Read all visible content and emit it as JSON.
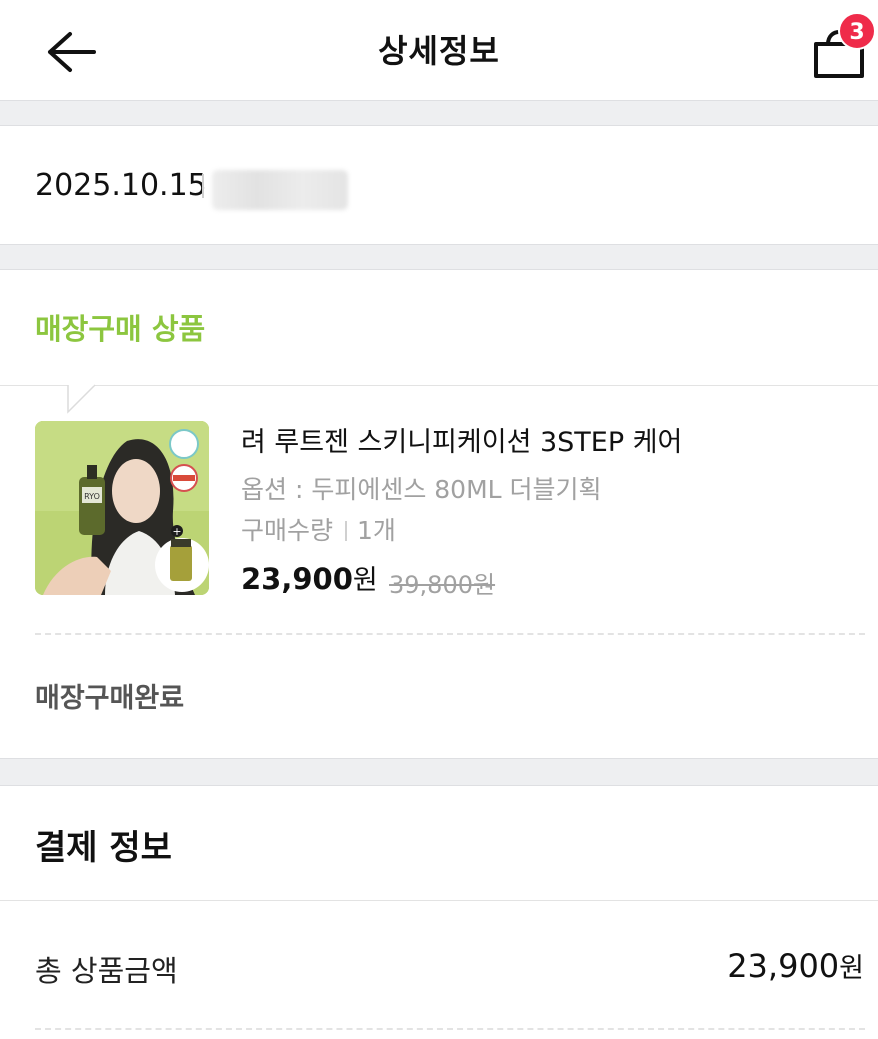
{
  "header": {
    "title": "상세정보",
    "cart_count": "3",
    "back_icon": "arrow-left-icon",
    "cart_icon": "shopping-bag-icon"
  },
  "order": {
    "date": "2025.10.15"
  },
  "instore": {
    "label": "매장구매 상품",
    "accent_color": "#8cc63f",
    "product": {
      "name": "려 루트젠 스키니피케이션 3STEP 케어",
      "option": "옵션 : 두피에센스 80ML 더블기획",
      "qty_label": "구매수량",
      "qty_value": "1개",
      "price": "23,900",
      "price_unit": "원",
      "original_price": "39,800원",
      "brand": "RYO"
    },
    "status": "매장구매완료"
  },
  "payment": {
    "title": "결제 정보",
    "total_label": "총 상품금액",
    "total_value": "23,900",
    "total_unit": "원"
  }
}
